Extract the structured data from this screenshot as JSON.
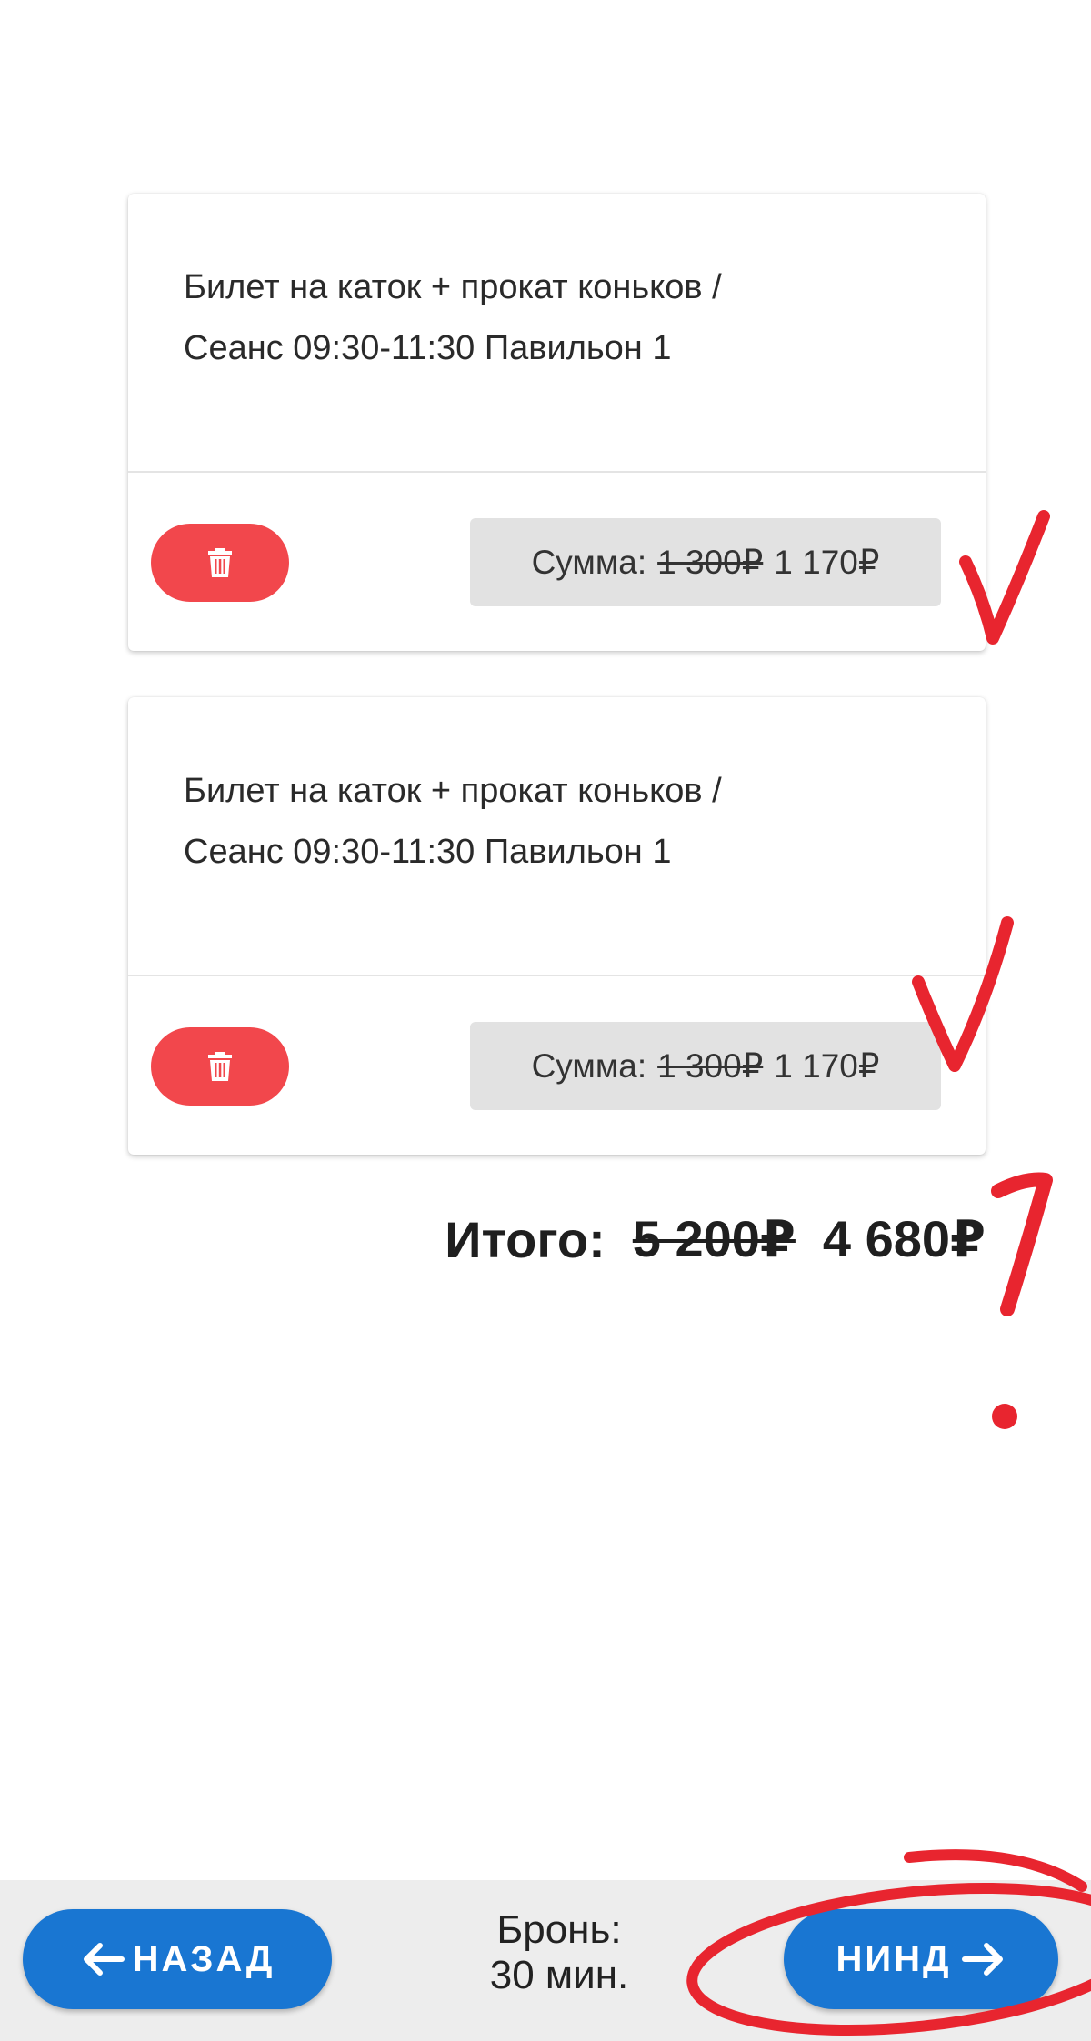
{
  "cart": {
    "items": [
      {
        "title_line1": "Билет на каток + прокат коньков /",
        "title_line2": "Сеанс 09:30-11:30 Павильон 1",
        "sum_label": "Сумма:",
        "old_price": "1 300₽",
        "new_price": "1 170₽"
      },
      {
        "title_line1": "Билет на каток + прокат коньков /",
        "title_line2": "Сеанс 09:30-11:30 Павильон 1",
        "sum_label": "Сумма:",
        "old_price": "1 300₽",
        "new_price": "1 170₽"
      }
    ],
    "total": {
      "label": "Итого:",
      "old_price": "5 200₽",
      "new_price": "4 680₽"
    }
  },
  "footer": {
    "back_label": "НАЗАД",
    "next_label": "НИНД",
    "booking_line1": "Бронь:",
    "booking_line2": "30 мин."
  },
  "icons": {
    "delete": "trash-icon",
    "back": "arrow-left-icon",
    "next": "arrow-right-icon"
  },
  "colors": {
    "delete_button": "#f2474c",
    "primary_button": "#1976d2",
    "annotation": "#e8252f"
  }
}
